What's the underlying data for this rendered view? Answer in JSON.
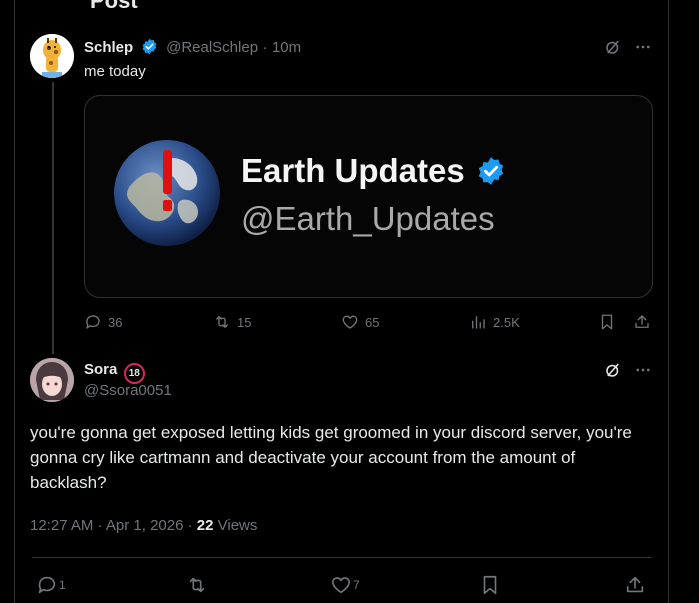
{
  "header": {
    "title_fragment": "Post"
  },
  "quoted_post": {
    "display_name": "Schlep",
    "handle": "@RealSchlep",
    "time": "10m",
    "separator": "·",
    "text": "me today",
    "media": {
      "name": "Earth Updates",
      "handle": "@Earth_Updates"
    },
    "actions": {
      "replies": "36",
      "reposts": "15",
      "likes": "65",
      "views": "2.5K"
    }
  },
  "reply_post": {
    "display_name": "Sora",
    "badge": "18",
    "handle": "@Ssora0051",
    "text": "you're gonna get exposed letting kids get groomed in your discord server, you're gonna cry like cartmann and deactivate your account from the amount of backlash?",
    "timestamp": "12:27 AM · Apr 1, 2026 ·",
    "views_count": "22",
    "views_label": "Views",
    "actions": {
      "replies": "1",
      "likes": "7"
    }
  },
  "colors": {
    "background": "#000000",
    "text": "#e7e9ea",
    "muted": "#71767b",
    "verified": "#1d9bf0",
    "border": "#2f3336"
  }
}
